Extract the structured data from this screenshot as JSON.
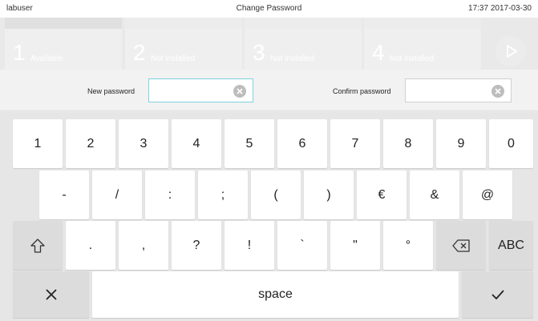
{
  "status_bar": {
    "user": "labuser",
    "title": "Change Password",
    "clock": "17:37 2017-03-30"
  },
  "modules": [
    {
      "number": "1",
      "state": "Available"
    },
    {
      "number": "2",
      "state": "Not installed"
    },
    {
      "number": "3",
      "state": "Not installed"
    },
    {
      "number": "4",
      "state": "Not installed"
    }
  ],
  "password_form": {
    "new_password_label": "New password",
    "new_password_value": "",
    "confirm_password_label": "Confirm password",
    "confirm_password_value": ""
  },
  "keyboard": {
    "row1": [
      "1",
      "2",
      "3",
      "4",
      "5",
      "6",
      "7",
      "8",
      "9",
      "0"
    ],
    "row2": [
      "-",
      "/",
      ":",
      ";",
      "(",
      ")",
      "€",
      "&",
      "@"
    ],
    "row3": [
      ".",
      ",",
      "?",
      "!",
      "`",
      "\"",
      "°"
    ],
    "abc_label": "ABC",
    "space_label": "space"
  },
  "icons": {
    "shift": "shift-arrow-icon",
    "backspace": "backspace-icon",
    "close": "close-icon",
    "enter": "checkmark-icon",
    "clear": "clear-x-icon",
    "play": "play-icon"
  }
}
